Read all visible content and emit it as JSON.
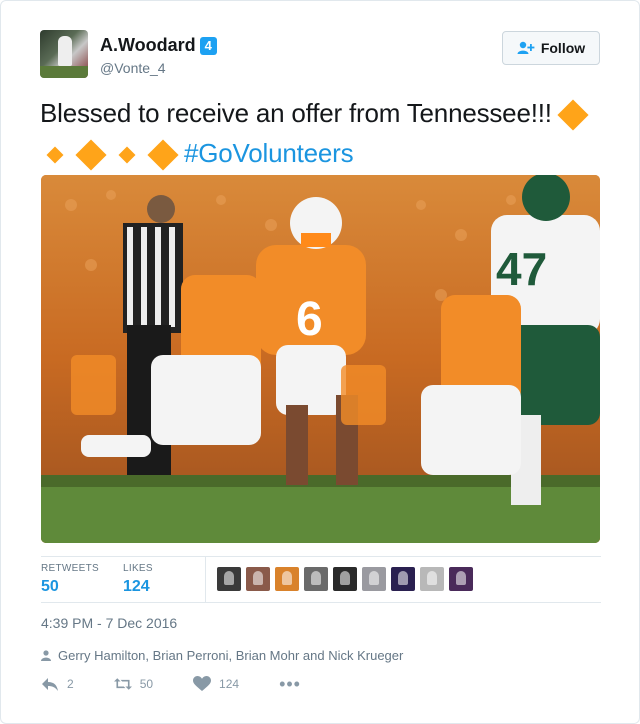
{
  "author": {
    "display_name": "A.Woodard",
    "badge": "4",
    "handle": "@Vonte_4"
  },
  "follow_button": {
    "label": "Follow"
  },
  "tweet": {
    "text_part1": "Blessed to receive an offer from Tennessee!!!",
    "hashtag": "#GoVolunteers",
    "emoji_name": "orange-diamond"
  },
  "stats": {
    "retweets_label": "RETWEETS",
    "retweets_count": "50",
    "likes_label": "LIKES",
    "likes_count": "124",
    "liker_avatar_count": 9
  },
  "timestamp": "4:39 PM - 7 Dec 2016",
  "context_line": "Gerry Hamilton, Brian Perroni, Brian Mohr and Nick Krueger",
  "actions": {
    "reply_count": "2",
    "retweet_count": "50",
    "like_count": "124"
  },
  "colors": {
    "link_blue": "#1b95e0",
    "badge_blue": "#1da1f2",
    "emoji_orange": "#ffa419",
    "muted_gray": "#657786"
  }
}
